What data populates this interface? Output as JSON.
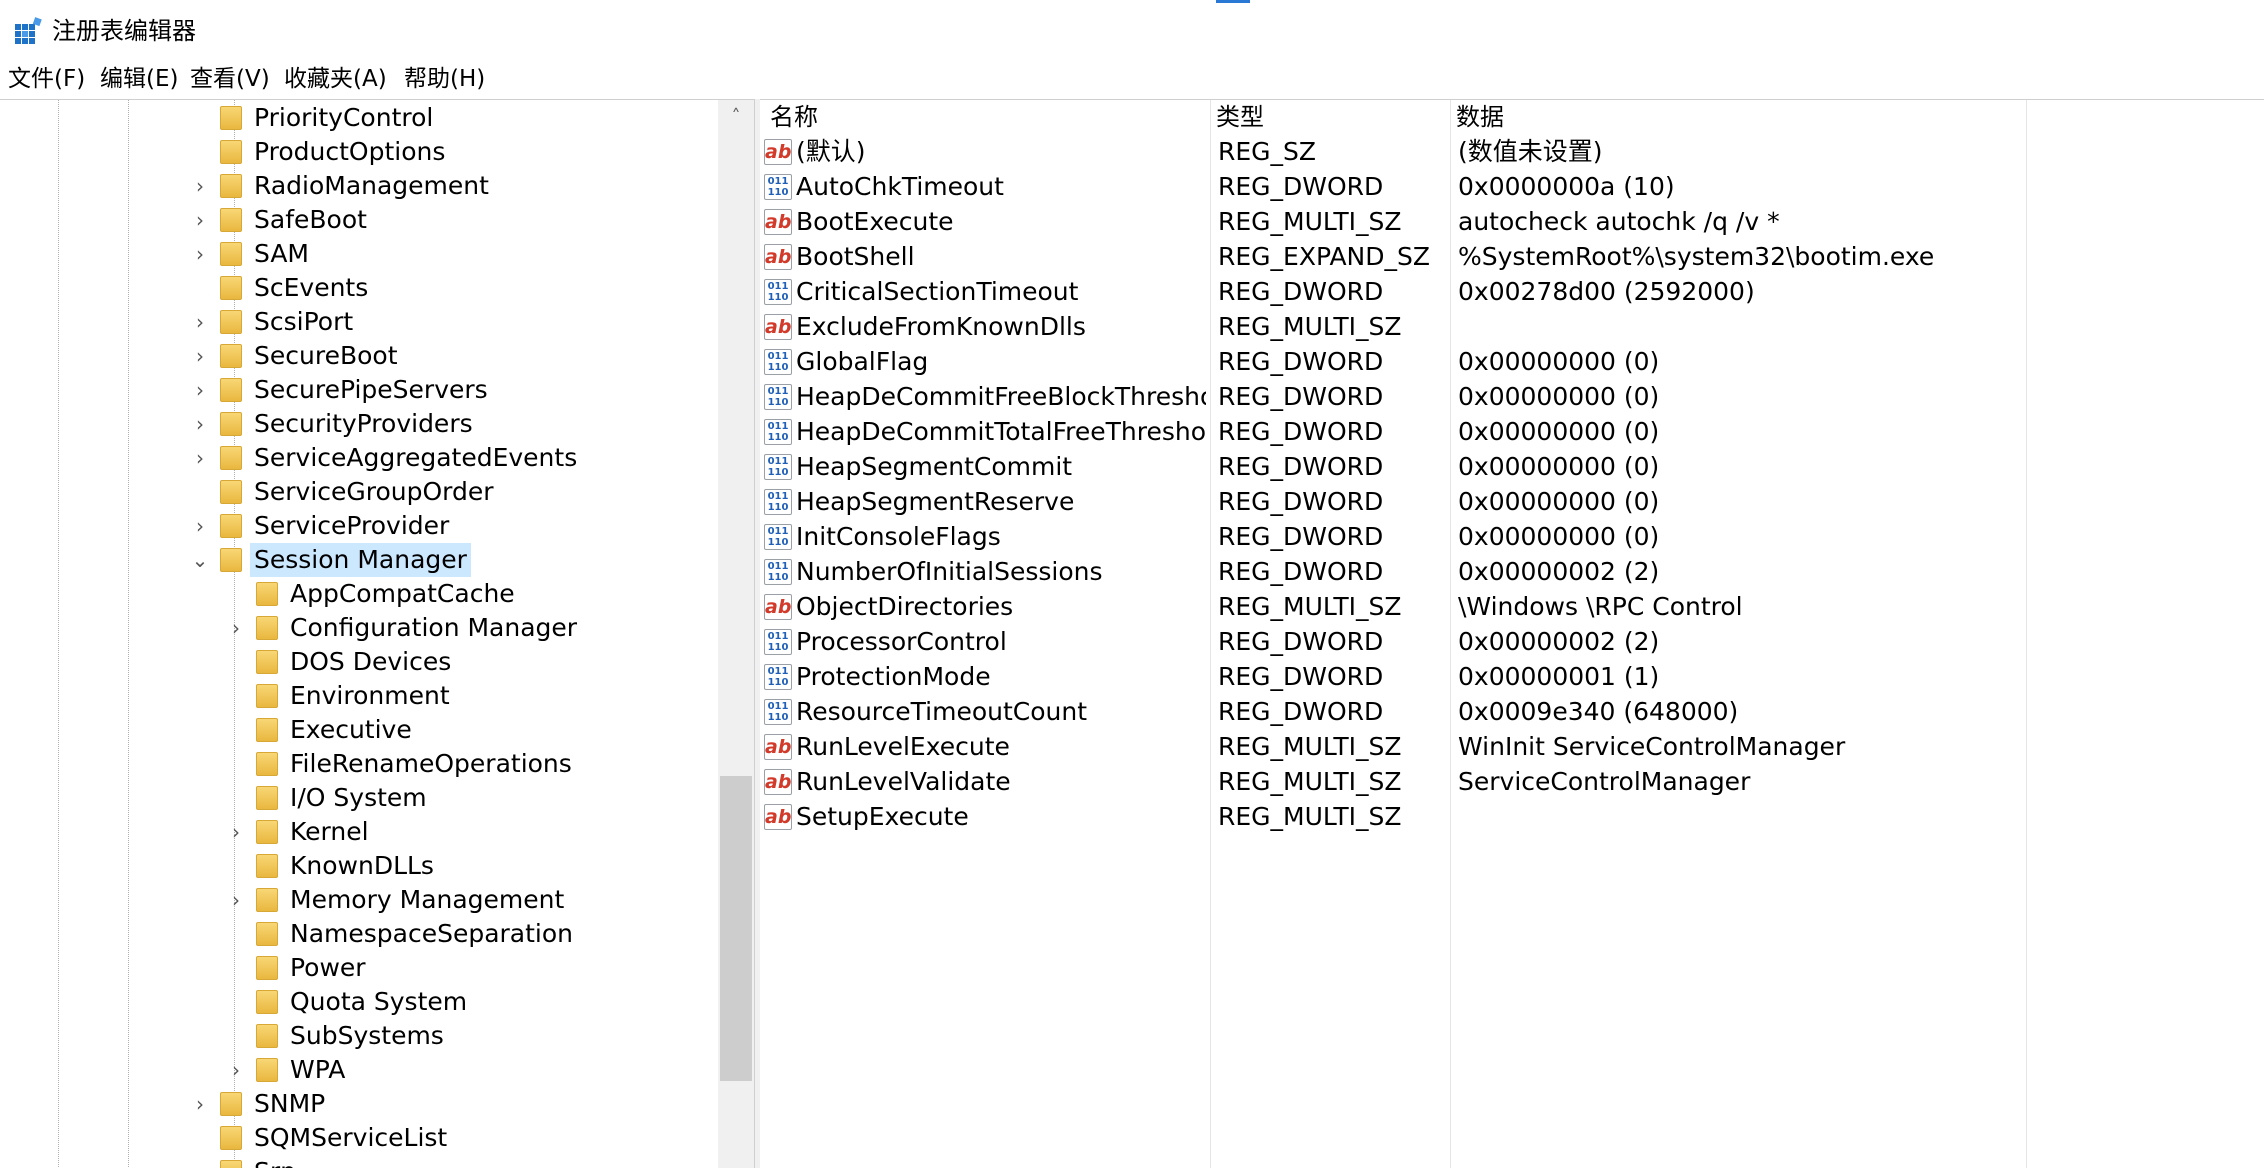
{
  "window": {
    "title": "注册表编辑器"
  },
  "menu": [
    {
      "label": "文件(F)"
    },
    {
      "label": "编辑(E)"
    },
    {
      "label": "查看(V)"
    },
    {
      "label": "收藏夹(A)"
    },
    {
      "label": "帮助(H)"
    }
  ],
  "tree": {
    "items": [
      {
        "label": "PriorityControl",
        "expander": ""
      },
      {
        "label": "ProductOptions",
        "expander": ""
      },
      {
        "label": "RadioManagement",
        "expander": "›"
      },
      {
        "label": "SafeBoot",
        "expander": "›"
      },
      {
        "label": "SAM",
        "expander": "›"
      },
      {
        "label": "ScEvents",
        "expander": ""
      },
      {
        "label": "ScsiPort",
        "expander": "›"
      },
      {
        "label": "SecureBoot",
        "expander": "›"
      },
      {
        "label": "SecurePipeServers",
        "expander": "›"
      },
      {
        "label": "SecurityProviders",
        "expander": "›"
      },
      {
        "label": "ServiceAggregatedEvents",
        "expander": "›"
      },
      {
        "label": "ServiceGroupOrder",
        "expander": ""
      },
      {
        "label": "ServiceProvider",
        "expander": "›"
      },
      {
        "label": "Session Manager",
        "expander": "⌄",
        "selected": true
      },
      {
        "label": "AppCompatCache",
        "expander": ""
      },
      {
        "label": "Configuration Manager",
        "expander": "›"
      },
      {
        "label": "DOS Devices",
        "expander": ""
      },
      {
        "label": "Environment",
        "expander": ""
      },
      {
        "label": "Executive",
        "expander": ""
      },
      {
        "label": "FileRenameOperations",
        "expander": ""
      },
      {
        "label": "I/O System",
        "expander": ""
      },
      {
        "label": "Kernel",
        "expander": "›"
      },
      {
        "label": "KnownDLLs",
        "expander": ""
      },
      {
        "label": "Memory Management",
        "expander": "›"
      },
      {
        "label": "NamespaceSeparation",
        "expander": ""
      },
      {
        "label": "Power",
        "expander": ""
      },
      {
        "label": "Quota System",
        "expander": ""
      },
      {
        "label": "SubSystems",
        "expander": ""
      },
      {
        "label": "WPA",
        "expander": "›"
      },
      {
        "label": "SNMP",
        "expander": "›"
      },
      {
        "label": "SQMServiceList",
        "expander": ""
      },
      {
        "label": "Srp",
        "expander": "›"
      }
    ]
  },
  "scrollbar": {
    "up_arrow": "˄"
  },
  "list": {
    "headers": {
      "name": "名称",
      "type": "类型",
      "data": "数据"
    },
    "rows": [
      {
        "icon": "string-value-icon",
        "name": "(默认)",
        "type": "REG_SZ",
        "data": "(数值未设置)"
      },
      {
        "icon": "binary-value-icon",
        "name": "AutoChkTimeout",
        "type": "REG_DWORD",
        "data": "0x0000000a (10)"
      },
      {
        "icon": "string-value-icon",
        "name": "BootExecute",
        "type": "REG_MULTI_SZ",
        "data": "autocheck autochk /q /v *"
      },
      {
        "icon": "string-value-icon",
        "name": "BootShell",
        "type": "REG_EXPAND_SZ",
        "data": "%SystemRoot%\\system32\\bootim.exe"
      },
      {
        "icon": "binary-value-icon",
        "name": "CriticalSectionTimeout",
        "type": "REG_DWORD",
        "data": "0x00278d00 (2592000)"
      },
      {
        "icon": "string-value-icon",
        "name": "ExcludeFromKnownDlls",
        "type": "REG_MULTI_SZ",
        "data": ""
      },
      {
        "icon": "binary-value-icon",
        "name": "GlobalFlag",
        "type": "REG_DWORD",
        "data": "0x00000000 (0)"
      },
      {
        "icon": "binary-value-icon",
        "name": "HeapDeCommitFreeBlockThreshold",
        "type": "REG_DWORD",
        "data": "0x00000000 (0)"
      },
      {
        "icon": "binary-value-icon",
        "name": "HeapDeCommitTotalFreeThreshold",
        "type": "REG_DWORD",
        "data": "0x00000000 (0)"
      },
      {
        "icon": "binary-value-icon",
        "name": "HeapSegmentCommit",
        "type": "REG_DWORD",
        "data": "0x00000000 (0)"
      },
      {
        "icon": "binary-value-icon",
        "name": "HeapSegmentReserve",
        "type": "REG_DWORD",
        "data": "0x00000000 (0)"
      },
      {
        "icon": "binary-value-icon",
        "name": "InitConsoleFlags",
        "type": "REG_DWORD",
        "data": "0x00000000 (0)"
      },
      {
        "icon": "binary-value-icon",
        "name": "NumberOfInitialSessions",
        "type": "REG_DWORD",
        "data": "0x00000002 (2)"
      },
      {
        "icon": "string-value-icon",
        "name": "ObjectDirectories",
        "type": "REG_MULTI_SZ",
        "data": "\\Windows \\RPC Control"
      },
      {
        "icon": "binary-value-icon",
        "name": "ProcessorControl",
        "type": "REG_DWORD",
        "data": "0x00000002 (2)"
      },
      {
        "icon": "binary-value-icon",
        "name": "ProtectionMode",
        "type": "REG_DWORD",
        "data": "0x00000001 (1)"
      },
      {
        "icon": "binary-value-icon",
        "name": "ResourceTimeoutCount",
        "type": "REG_DWORD",
        "data": "0x0009e340 (648000)"
      },
      {
        "icon": "string-value-icon",
        "name": "RunLevelExecute",
        "type": "REG_MULTI_SZ",
        "data": "WinInit ServiceControlManager"
      },
      {
        "icon": "string-value-icon",
        "name": "RunLevelValidate",
        "type": "REG_MULTI_SZ",
        "data": "ServiceControlManager"
      },
      {
        "icon": "string-value-icon",
        "name": "SetupExecute",
        "type": "REG_MULTI_SZ",
        "data": ""
      }
    ]
  },
  "icons": {
    "string_glyph": "ab",
    "binary_glyph": "011\n110"
  },
  "colors": {
    "selection": "#cce8ff",
    "folder": "#e9b73f",
    "string_icon": "#d23a2a",
    "binary_icon": "#1f5fb8"
  }
}
